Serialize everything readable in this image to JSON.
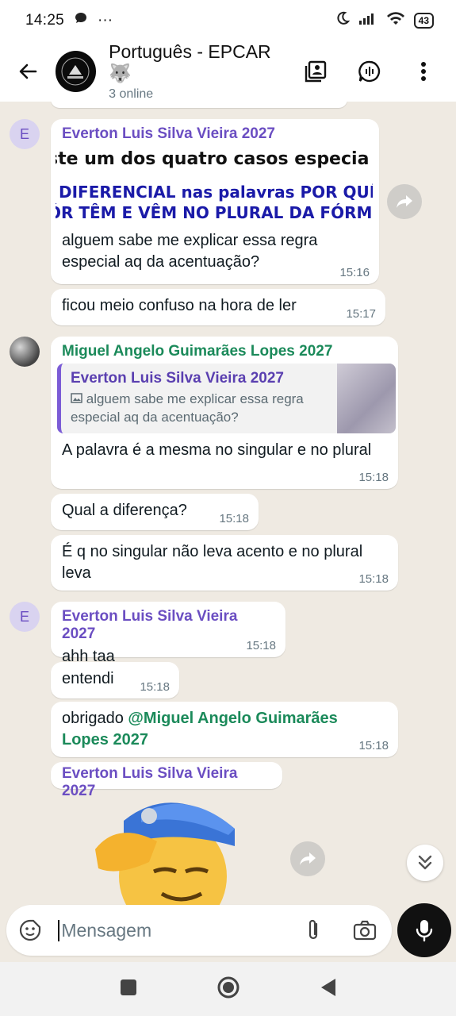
{
  "status_bar": {
    "time": "14:25",
    "more": "···",
    "battery": "43"
  },
  "header": {
    "title": "Português - EPCAR 🐺",
    "subtitle": "3 online"
  },
  "messages": {
    "m1": {
      "sender": "Everton Luis Silva Vieira 2027",
      "avatar_initial": "E",
      "image_text_1": "ste um dos quatro casos especia",
      "image_text_2": "DIFERENCIAL nas palavras POR QUÊ",
      "image_text_3": "ÓR TÊM E VÊM NO PLURAL DA FÓRM",
      "text": "alguem sabe me explicar essa regra especial aq da acentuação?",
      "time": "15:16"
    },
    "m2": {
      "text": "ficou meio confuso na hora de ler",
      "time": "15:17"
    },
    "m3": {
      "sender": "Miguel Angelo Guimarães Lopes 2027",
      "quote_name": "Everton Luis Silva Vieira 2027",
      "quote_text": "alguem sabe me explicar essa regra especial aq da acentuação?",
      "text": "A palavra é a mesma no singular e no plural",
      "time": "15:18"
    },
    "m4": {
      "text": "Qual a diferença?",
      "time": "15:18"
    },
    "m5": {
      "text": "É q no singular não leva acento e no plural leva",
      "time": "15:18"
    },
    "m6": {
      "sender": "Everton Luis Silva Vieira 2027",
      "avatar_initial": "E",
      "text": "ahh taa",
      "time": "15:18"
    },
    "m7": {
      "text": "entendi",
      "time": "15:18"
    },
    "m8": {
      "text_prefix": "obrigado ",
      "mention": "@Miguel Angelo Guimarães Lopes 2027",
      "time": "15:18"
    },
    "m9": {
      "sender": "Everton Luis Silva Vieira 2027"
    }
  },
  "composer": {
    "placeholder": "Mensagem"
  },
  "colors": {
    "sender_purple": "#6b4ec2",
    "sender_green": "#1b8a5a",
    "chat_bg": "#efeae2"
  }
}
